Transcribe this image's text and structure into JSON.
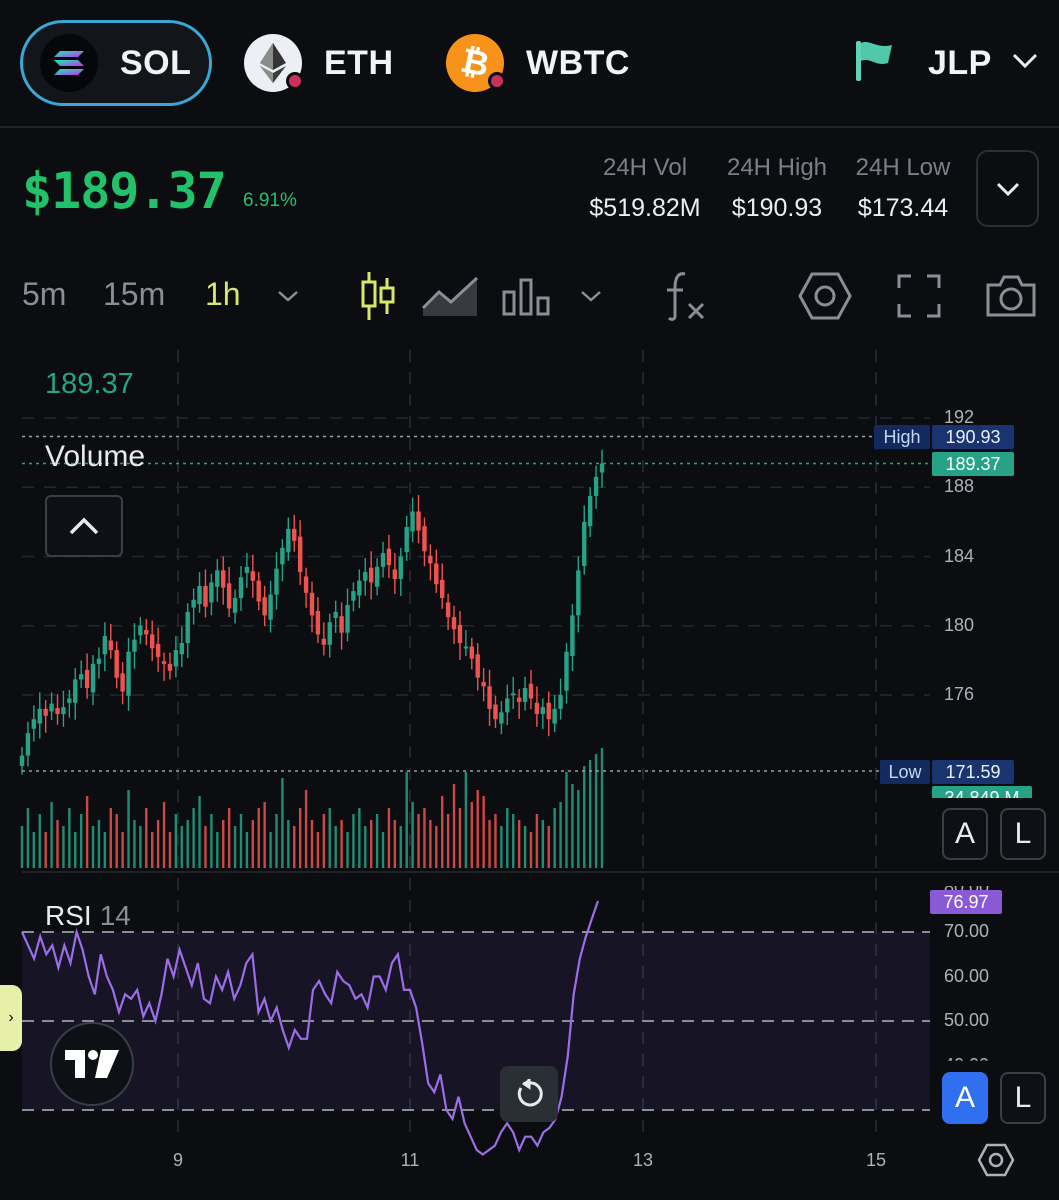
{
  "tabs": [
    {
      "label": "SOL",
      "active": true,
      "icon": "solana-icon"
    },
    {
      "label": "ETH",
      "active": false,
      "icon": "ethereum-icon"
    },
    {
      "label": "WBTC",
      "active": false,
      "icon": "bitcoin-icon"
    }
  ],
  "pool_selector": {
    "label": "JLP",
    "icon": "flag-icon"
  },
  "ticker": {
    "price": "$189.37",
    "change_pct": "6.91%",
    "stats": [
      {
        "label": "24H Vol",
        "value": "$519.82M"
      },
      {
        "label": "24H High",
        "value": "$190.93"
      },
      {
        "label": "24H Low",
        "value": "$173.44"
      }
    ]
  },
  "toolbar": {
    "timeframes": [
      {
        "label": "5m",
        "active": false
      },
      {
        "label": "15m",
        "active": false
      },
      {
        "label": "1h",
        "active": true
      }
    ],
    "icons": [
      "chevron-down-icon",
      "candlestick-icon",
      "area-chart-icon",
      "bar-chart-icon",
      "chevron-down-icon",
      "indicator-fx-icon",
      "settings-hex-icon",
      "fullscreen-icon",
      "camera-icon"
    ]
  },
  "legend": {
    "last_price": "189.37",
    "volume_label": "Volume",
    "rsi_label": "RSI",
    "rsi_period": "14"
  },
  "price_axis": {
    "ticks": [
      "192",
      "188",
      "184",
      "180",
      "176"
    ],
    "high_tag": {
      "label": "High",
      "value": "190.93"
    },
    "current_tag": "189.37",
    "low_tag": {
      "label": "Low",
      "value": "171.59"
    },
    "volume_tag": "34.849 M"
  },
  "rsi_axis": {
    "ticks": [
      "80.00",
      "70.00",
      "60.00",
      "50.00",
      "40.00"
    ],
    "current_tag": "76.97"
  },
  "buttons": {
    "auto": "A",
    "log": "L"
  },
  "x_axis": {
    "ticks": [
      "9",
      "11",
      "13",
      "15"
    ]
  },
  "colors": {
    "up": "#26a387",
    "down": "#ef5350",
    "accent": "#3aa7d6",
    "rsi": "#9b6ee6",
    "active_tf": "#d8e86a",
    "positive": "#22c26b"
  },
  "chart_data": {
    "type": "candlestick",
    "x_ticks": [
      "9",
      "11",
      "13",
      "15"
    ],
    "price_ticks": [
      192,
      188,
      184,
      180,
      176
    ],
    "high": 190.93,
    "low": 171.59,
    "last": 189.37,
    "ohlc_close_path": [
      172.5,
      173.8,
      174.6,
      175.2,
      174.8,
      175.5,
      174.9,
      175.3,
      175.8,
      176.9,
      177.2,
      176.4,
      177.8,
      178.1,
      179.4,
      178.6,
      177.0,
      176.2,
      178.5,
      179.2,
      180.0,
      179.5,
      178.7,
      178.2,
      177.8,
      177.4,
      178.6,
      179.0,
      180.8,
      181.5,
      182.3,
      181.1,
      182.5,
      183.2,
      182.2,
      181.0,
      181.6,
      182.8,
      183.4,
      182.6,
      181.4,
      180.6,
      181.8,
      183.3,
      184.5,
      185.6,
      184.9,
      183.1,
      181.9,
      180.6,
      179.5,
      178.9,
      180.2,
      180.8,
      179.6,
      181.2,
      182.0,
      182.6,
      183.1,
      182.5,
      183.4,
      184.2,
      183.5,
      182.7,
      184.0,
      185.7,
      186.6,
      185.5,
      184.3,
      183.6,
      182.4,
      181.6,
      180.5,
      179.8,
      179.0,
      178.8,
      178.1,
      177.0,
      176.5,
      175.2,
      174.6,
      175.0,
      175.8,
      176.1,
      175.6,
      176.4,
      175.8,
      174.9,
      175.3,
      174.6,
      175.2,
      176.0,
      178.5,
      180.6,
      183.2,
      186.0,
      187.5,
      188.6,
      189.37
    ],
    "volume_relative": [
      0.35,
      0.5,
      0.3,
      0.45,
      0.3,
      0.55,
      0.4,
      0.35,
      0.5,
      0.3,
      0.45,
      0.6,
      0.35,
      0.4,
      0.3,
      0.5,
      0.45,
      0.3,
      0.65,
      0.4,
      0.35,
      0.5,
      0.3,
      0.4,
      0.55,
      0.3,
      0.45,
      0.35,
      0.4,
      0.5,
      0.6,
      0.35,
      0.45,
      0.3,
      0.4,
      0.5,
      0.35,
      0.45,
      0.3,
      0.4,
      0.5,
      0.55,
      0.3,
      0.45,
      0.75,
      0.4,
      0.35,
      0.5,
      0.65,
      0.4,
      0.3,
      0.45,
      0.5,
      0.35,
      0.4,
      0.3,
      0.45,
      0.5,
      0.35,
      0.4,
      0.45,
      0.3,
      0.5,
      0.4,
      0.35,
      0.8,
      0.55,
      0.45,
      0.5,
      0.4,
      0.35,
      0.6,
      0.45,
      0.7,
      0.5,
      0.8,
      0.55,
      0.65,
      0.6,
      0.4,
      0.45,
      0.35,
      0.5,
      0.45,
      0.4,
      0.35,
      0.3,
      0.45,
      0.4,
      0.35,
      0.5,
      0.55,
      0.8,
      0.7,
      0.65,
      0.85,
      0.9,
      0.95,
      1.0
    ],
    "rsi": [
      70,
      67,
      64,
      69,
      65,
      67,
      62,
      67,
      63,
      70,
      66,
      60,
      56,
      65,
      60,
      57,
      52,
      56,
      55,
      57,
      51,
      54,
      50,
      56,
      64,
      60,
      66,
      62,
      58,
      63,
      55,
      54,
      60,
      57,
      61,
      55,
      58,
      63,
      65,
      52,
      55,
      50,
      53,
      48,
      44,
      48,
      46,
      46,
      57,
      59,
      56,
      54,
      61,
      59,
      58,
      55,
      56,
      53,
      60,
      60,
      57,
      63,
      65,
      57,
      57,
      53,
      45,
      36,
      34,
      38,
      30,
      28,
      33,
      27,
      24,
      21,
      20,
      21,
      22,
      25,
      27,
      25,
      21,
      24,
      24,
      22,
      25,
      26,
      28,
      33,
      42,
      56,
      64,
      69,
      73,
      76.97
    ],
    "rsi_range": [
      20,
      80
    ]
  }
}
